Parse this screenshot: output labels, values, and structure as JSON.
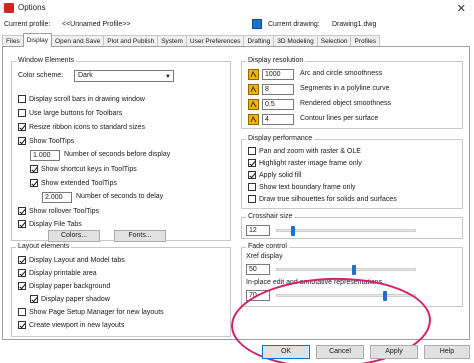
{
  "window": {
    "title": "Options",
    "close_glyph": "✕"
  },
  "profile": {
    "label": "Current profile:",
    "value": "<<Unnamed Profile>>",
    "drawing_label": "Current drawing:",
    "drawing_value": "Drawing1.dwg"
  },
  "tabs": [
    {
      "label": "Files"
    },
    {
      "label": "Display"
    },
    {
      "label": "Open and Save"
    },
    {
      "label": "Plot and Publish"
    },
    {
      "label": "System"
    },
    {
      "label": "User Preferences"
    },
    {
      "label": "Drafting"
    },
    {
      "label": "3D Modeling"
    },
    {
      "label": "Selection"
    },
    {
      "label": "Profiles"
    }
  ],
  "window_elements": {
    "legend": "Window Elements",
    "color_scheme_label": "Color scheme:",
    "color_scheme_value": "Dark",
    "checks": [
      {
        "label": "Display scroll bars in drawing window",
        "checked": false
      },
      {
        "label": "Use large buttons for Toolbars",
        "checked": false
      },
      {
        "label": "Resize ribbon icons to standard sizes",
        "checked": true
      },
      {
        "label": "Show ToolTips",
        "checked": true
      }
    ],
    "tooltip_delay_value": "1.000",
    "tooltip_delay_label": "Number of seconds before display",
    "shortcut_keys_label": "Show shortcut keys in ToolTips",
    "extended_label": "Show extended ToolTips",
    "extended_delay_value": "2.000",
    "extended_delay_label": "Number of seconds to delay",
    "rollover_label": "Show rollover ToolTips",
    "file_tabs_label": "Display File Tabs",
    "colors_button": "Colors...",
    "fonts_button": "Fonts..."
  },
  "layout_elements": {
    "legend": "Layout elements",
    "checks": [
      {
        "label": "Display Layout and Model tabs",
        "checked": true
      },
      {
        "label": "Display printable area",
        "checked": true
      },
      {
        "label": "Display paper background",
        "checked": true
      },
      {
        "label": "Display paper shadow",
        "checked": true
      },
      {
        "label": "Show Page Setup Manager for new layouts",
        "checked": false
      },
      {
        "label": "Create viewport in new layouts",
        "checked": true
      }
    ]
  },
  "display_resolution": {
    "legend": "Display resolution",
    "rows": [
      {
        "value": "1000",
        "label": "Arc and circle smoothness"
      },
      {
        "value": "8",
        "label": "Segments in a polyline curve"
      },
      {
        "value": "0.5",
        "label": "Rendered object smoothness"
      },
      {
        "value": "4",
        "label": "Contour lines per surface"
      }
    ]
  },
  "display_performance": {
    "legend": "Display performance",
    "checks": [
      {
        "label": "Pan and zoom with raster & OLE",
        "checked": false
      },
      {
        "label": "Highlight raster image frame only",
        "checked": true
      },
      {
        "label": "Apply solid fill",
        "checked": true
      },
      {
        "label": "Show text boundary frame only",
        "checked": false
      },
      {
        "label": "Draw true silhouettes for solids and surfaces",
        "checked": false
      }
    ]
  },
  "crosshair": {
    "legend": "Crosshair size",
    "value": "12",
    "slider_level": 12
  },
  "fade_control": {
    "legend": "Fade control",
    "xref_label": "Xref display",
    "xref_value": "50",
    "xref_level": 50,
    "inplace_label": "In-place edit and annotative representations",
    "inplace_value": "70",
    "inplace_level": 70
  },
  "footer": {
    "ok": "OK",
    "cancel": "Cancel",
    "apply": "Apply",
    "help": "Help"
  },
  "colors": {
    "accent": "#1e6fd0",
    "annotation": "#d2236a"
  }
}
